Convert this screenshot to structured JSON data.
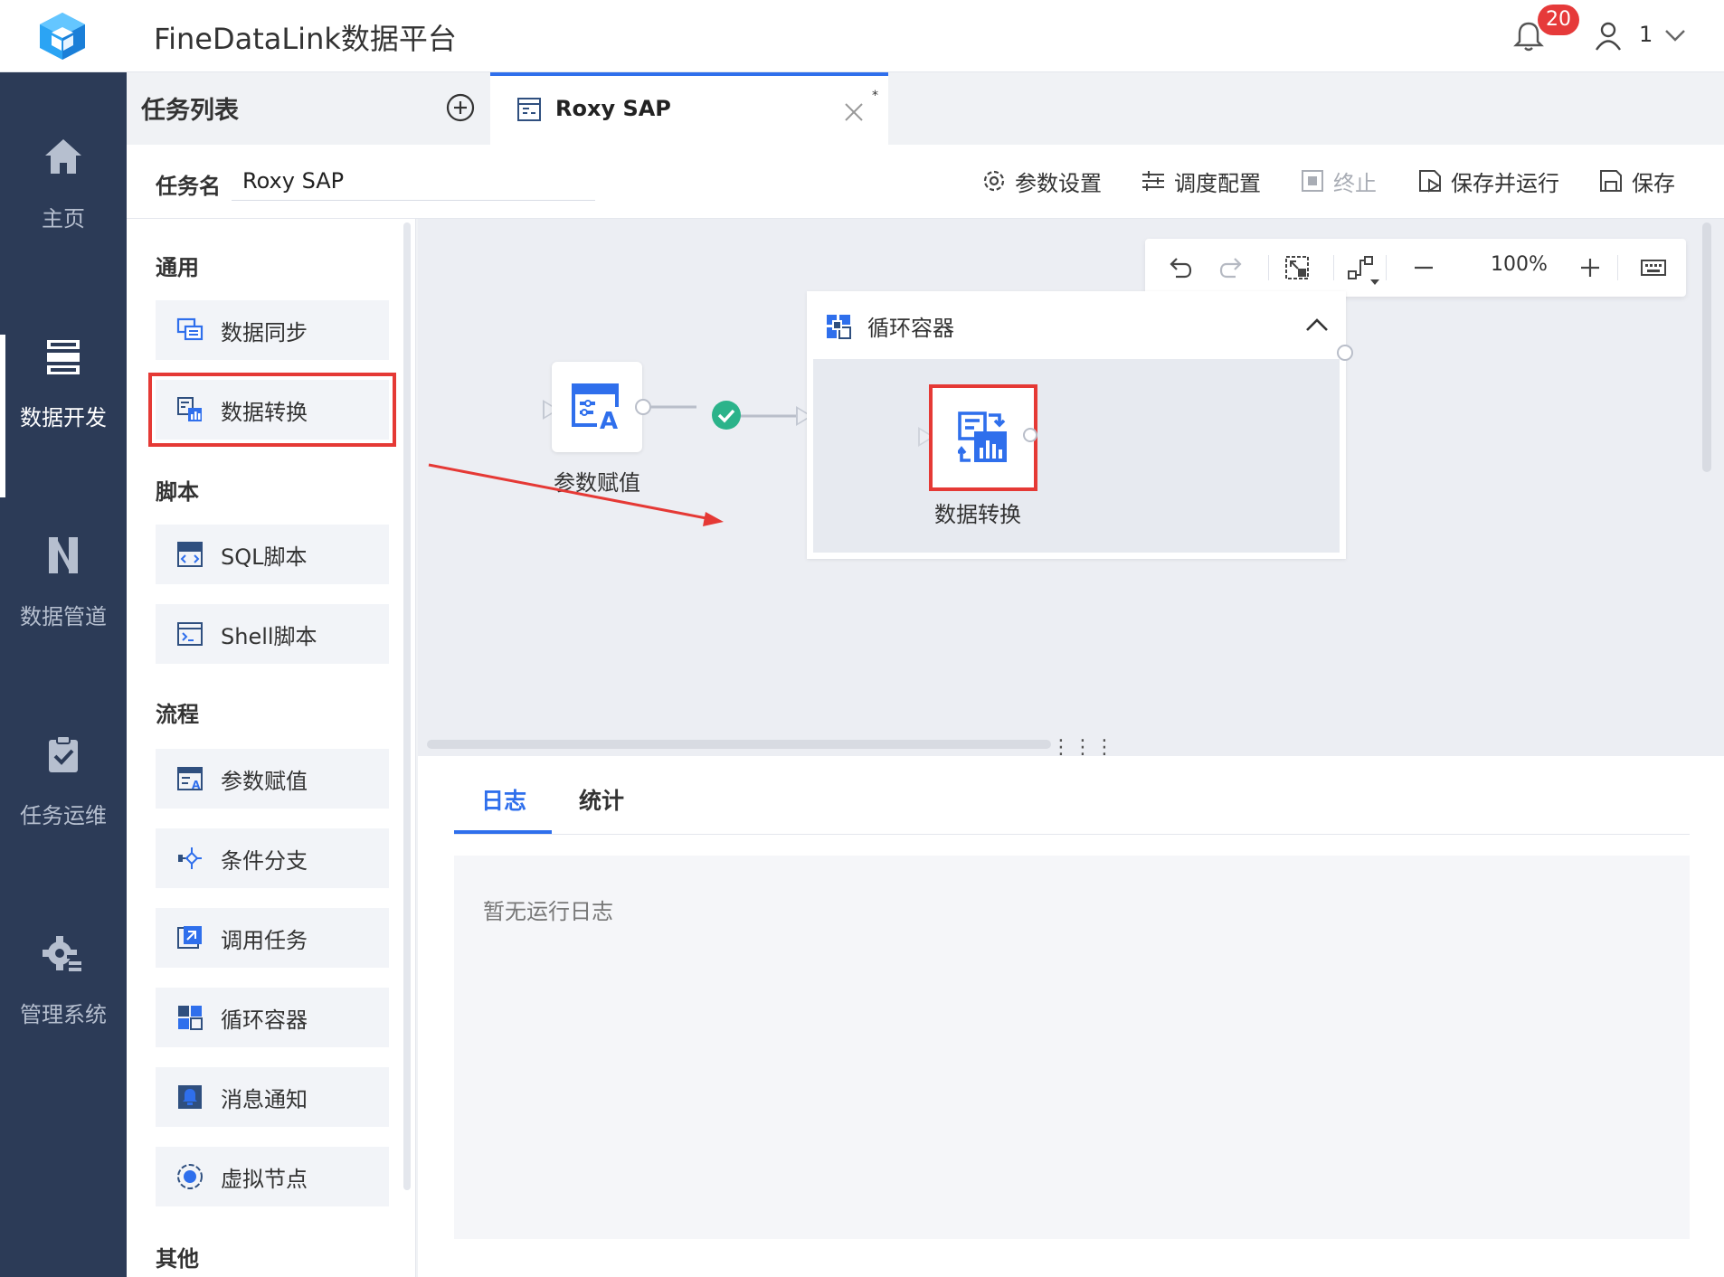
{
  "app": {
    "title": "FineDataLink数据平台"
  },
  "header": {
    "notification_count": "20",
    "user_name": "1"
  },
  "leftnav": {
    "items": [
      {
        "label": "主页",
        "icon": "home-icon"
      },
      {
        "label": "数据开发",
        "icon": "data-dev-icon",
        "active": true
      },
      {
        "label": "数据管道",
        "icon": "pipeline-icon"
      },
      {
        "label": "任务运维",
        "icon": "task-ops-icon"
      },
      {
        "label": "管理系统",
        "icon": "system-gear-icon"
      }
    ]
  },
  "tabs": {
    "list_title": "任务列表",
    "open_tab": {
      "label": "Roxy SAP",
      "dirty_mark": "*"
    }
  },
  "task": {
    "name_label": "任务名",
    "name_value": "Roxy SAP",
    "toolbar": {
      "params": "参数设置",
      "schedule": "调度配置",
      "stop": "终止",
      "save_run": "保存并运行",
      "save": "保存"
    }
  },
  "panel": {
    "sections": {
      "general": "通用",
      "script": "脚本",
      "flow": "流程",
      "other": "其他"
    },
    "items": {
      "data_sync": "数据同步",
      "data_transform": "数据转换",
      "sql_script": "SQL脚本",
      "shell_script": "Shell脚本",
      "param_assign": "参数赋值",
      "condition_branch": "条件分支",
      "invoke_task": "调用任务",
      "loop_container": "循环容器",
      "message_notify": "消息通知",
      "virtual_node": "虚拟节点"
    }
  },
  "canvas": {
    "zoom_level": "100%",
    "nodes": {
      "param_assign": "参数赋值",
      "loop_container": "循环容器",
      "data_transform": "数据转换"
    }
  },
  "log": {
    "tabs": {
      "log": "日志",
      "stats": "统计"
    },
    "empty_text": "暂无运行日志"
  },
  "colors": {
    "accent": "#2f6fec",
    "nav_bg": "#2c3b57",
    "highlight": "#e53935",
    "success": "#2bb38a"
  }
}
